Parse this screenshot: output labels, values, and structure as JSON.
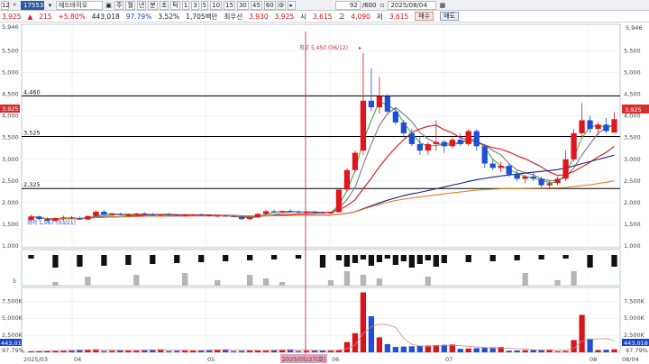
{
  "toolbar": {
    "code_prefix": "12",
    "stock_code": "17553",
    "stock_name": "에드바이오",
    "period_buttons": [
      "주",
      "월",
      "년",
      "분",
      "초",
      "틱"
    ],
    "interval_buttons": [
      "1",
      "3",
      "5",
      "10",
      "15",
      "30",
      "45",
      "60"
    ],
    "count": "92",
    "count_total": "/600",
    "date": "2025/08/04"
  },
  "quote": {
    "price": "3,925",
    "change": "215",
    "change_pct": "+5.80%",
    "volume": "443,018",
    "volume_ratio": "97.79%",
    "turnover_pct": "3.52%",
    "amount_label": "1,705백만",
    "prev_close_label": "최우선",
    "ask": "3,930",
    "bid": "3,925",
    "open_label": "시",
    "open": "3,615",
    "high_label": "고",
    "high": "4,090",
    "low_label": "저",
    "low": "3,615",
    "buy_label": "매수",
    "sell_label": "매도"
  },
  "price_axis": {
    "ticks": [
      "5,500",
      "5,000",
      "4,500",
      "4,000",
      "3,500",
      "3,000",
      "2,500",
      "2,000",
      "1,500",
      "1,000"
    ],
    "top_left": "5,946",
    "top_right": "5,946",
    "current_tag": "3,925",
    "ratio_tag": "3,525"
  },
  "lines": {
    "upper": "4,460",
    "middle": "3,525",
    "lower": "2,325"
  },
  "annotations": {
    "high_note": "최고 5,450 (06/12)",
    "low_note": "최저 1,567 (03/21)"
  },
  "indicator_axis": {
    "tick": "5"
  },
  "volume_axis": {
    "ticks": [
      "7,500K",
      "5,000K",
      "2,500K"
    ],
    "current_left": "443,018",
    "current_right": "443,018",
    "ratio_left": "97.79%",
    "ratio_right": "97.79%"
  },
  "date_axis": {
    "labels": [
      "2025/03",
      "04",
      "05",
      "06",
      "07",
      "08",
      "08/04"
    ],
    "crosshair_date": "2025/05/27(화)"
  },
  "chart_data": {
    "type": "candlestick",
    "ylim": [
      1000,
      5946
    ],
    "lines": [
      4460,
      3525,
      2325
    ],
    "high": {
      "value": 5450,
      "date": "06/12"
    },
    "low": {
      "value": 1567,
      "date": "03/21"
    },
    "candles": [
      [
        1600,
        1720,
        1560,
        1680
      ],
      [
        1680,
        1700,
        1600,
        1620
      ],
      [
        1620,
        1660,
        1560,
        1580
      ],
      [
        1580,
        1650,
        1560,
        1640
      ],
      [
        1640,
        1700,
        1600,
        1660
      ],
      [
        1660,
        1690,
        1620,
        1640
      ],
      [
        1640,
        1680,
        1600,
        1610
      ],
      [
        1610,
        1700,
        1600,
        1690
      ],
      [
        1690,
        1820,
        1680,
        1790
      ],
      [
        1790,
        1830,
        1700,
        1720
      ],
      [
        1720,
        1760,
        1690,
        1740
      ],
      [
        1740,
        1770,
        1700,
        1710
      ],
      [
        1710,
        1740,
        1680,
        1720
      ],
      [
        1720,
        1760,
        1700,
        1750
      ],
      [
        1750,
        1780,
        1720,
        1730
      ],
      [
        1730,
        1760,
        1690,
        1700
      ],
      [
        1700,
        1740,
        1680,
        1730
      ],
      [
        1730,
        1760,
        1710,
        1720
      ],
      [
        1720,
        1740,
        1690,
        1700
      ],
      [
        1700,
        1720,
        1680,
        1710
      ],
      [
        1710,
        1740,
        1700,
        1720
      ],
      [
        1720,
        1750,
        1700,
        1710
      ],
      [
        1710,
        1730,
        1680,
        1690
      ],
      [
        1690,
        1710,
        1660,
        1700
      ],
      [
        1700,
        1720,
        1680,
        1690
      ],
      [
        1690,
        1710,
        1660,
        1670
      ],
      [
        1670,
        1700,
        1600,
        1620
      ],
      [
        1620,
        1680,
        1600,
        1660
      ],
      [
        1660,
        1760,
        1650,
        1740
      ],
      [
        1740,
        1830,
        1720,
        1800
      ],
      [
        1800,
        1840,
        1760,
        1780
      ],
      [
        1780,
        1820,
        1760,
        1810
      ],
      [
        1810,
        1850,
        1780,
        1790
      ],
      [
        1790,
        1820,
        1750,
        1770
      ],
      [
        1770,
        1800,
        1740,
        1790
      ],
      [
        1790,
        1810,
        1760,
        1770
      ],
      [
        1770,
        1800,
        1740,
        1750
      ],
      [
        1750,
        1790,
        1730,
        1780
      ],
      [
        1780,
        1880,
        1770,
        2300
      ],
      [
        2300,
        2800,
        2250,
        2750
      ],
      [
        2750,
        3200,
        2700,
        3150
      ],
      [
        3200,
        5450,
        3100,
        4350
      ],
      [
        4350,
        5100,
        4100,
        4200
      ],
      [
        4200,
        4900,
        4050,
        4450
      ],
      [
        4450,
        4500,
        4050,
        4100
      ],
      [
        4100,
        4200,
        3800,
        3850
      ],
      [
        3850,
        3900,
        3500,
        3600
      ],
      [
        3600,
        3700,
        3300,
        3350
      ],
      [
        3350,
        3500,
        3100,
        3200
      ],
      [
        3200,
        3400,
        3100,
        3350
      ],
      [
        3350,
        3900,
        3200,
        3400
      ],
      [
        3400,
        3450,
        3150,
        3300
      ],
      [
        3300,
        3500,
        3250,
        3450
      ],
      [
        3450,
        3600,
        3300,
        3350
      ],
      [
        3350,
        3700,
        3300,
        3650
      ],
      [
        3650,
        3700,
        3200,
        3300
      ],
      [
        3300,
        3350,
        2800,
        2900
      ],
      [
        2900,
        3000,
        2750,
        2800
      ],
      [
        2800,
        2950,
        2700,
        2850
      ],
      [
        2850,
        2900,
        2600,
        2650
      ],
      [
        2650,
        2750,
        2500,
        2550
      ],
      [
        2550,
        2650,
        2450,
        2600
      ],
      [
        2600,
        2700,
        2500,
        2550
      ],
      [
        2550,
        2600,
        2350,
        2400
      ],
      [
        2400,
        2500,
        2300,
        2450
      ],
      [
        2450,
        2600,
        2400,
        2550
      ],
      [
        2550,
        3200,
        2500,
        3000
      ],
      [
        3000,
        3700,
        2950,
        3600
      ],
      [
        3600,
        4300,
        3500,
        3900
      ],
      [
        3900,
        4000,
        3600,
        3700
      ],
      [
        3700,
        3850,
        3550,
        3800
      ],
      [
        3800,
        3950,
        3600,
        3650
      ],
      [
        3615,
        4090,
        3615,
        3925
      ]
    ],
    "volume_peaks": {
      "first": "06/11",
      "second": "07/28"
    }
  }
}
